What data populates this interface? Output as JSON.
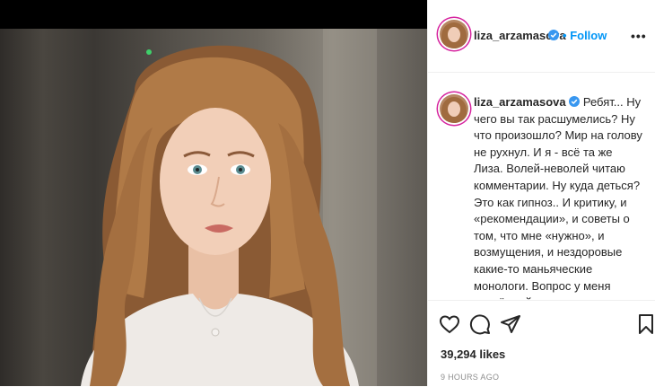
{
  "post": {
    "username": "liza_arzamasova",
    "follow_label": "Follow",
    "separator": "•",
    "more_label": "•••",
    "caption_text": "Ребят... Ну чего вы так расшумелись? Ну что произошло? Мир на голову не рухнул. И я - всё та же Лиза. Волей-неволей читаю комментарии. Ну куда деться? Это как гипноз.. И критику, и «рекомендации», и советы о том, что мне «нужно», и возмущения, и нездоровые какие-то маньяческие монологи. Вопрос у меня серьёзный: чего случилось-то в нашем королевстве??? 🤷‍♀️ Мы с",
    "likes": "39,294 likes",
    "timestamp": "9 HOURS AGO"
  },
  "icons": {
    "verified": "verified-badge-icon",
    "like": "heart-icon",
    "comment": "comment-icon",
    "share": "paper-plane-icon",
    "save": "bookmark-icon"
  },
  "colors": {
    "follow": "#0095f6",
    "verified": "#3897f0",
    "avatar_ring": "#d6249f"
  }
}
